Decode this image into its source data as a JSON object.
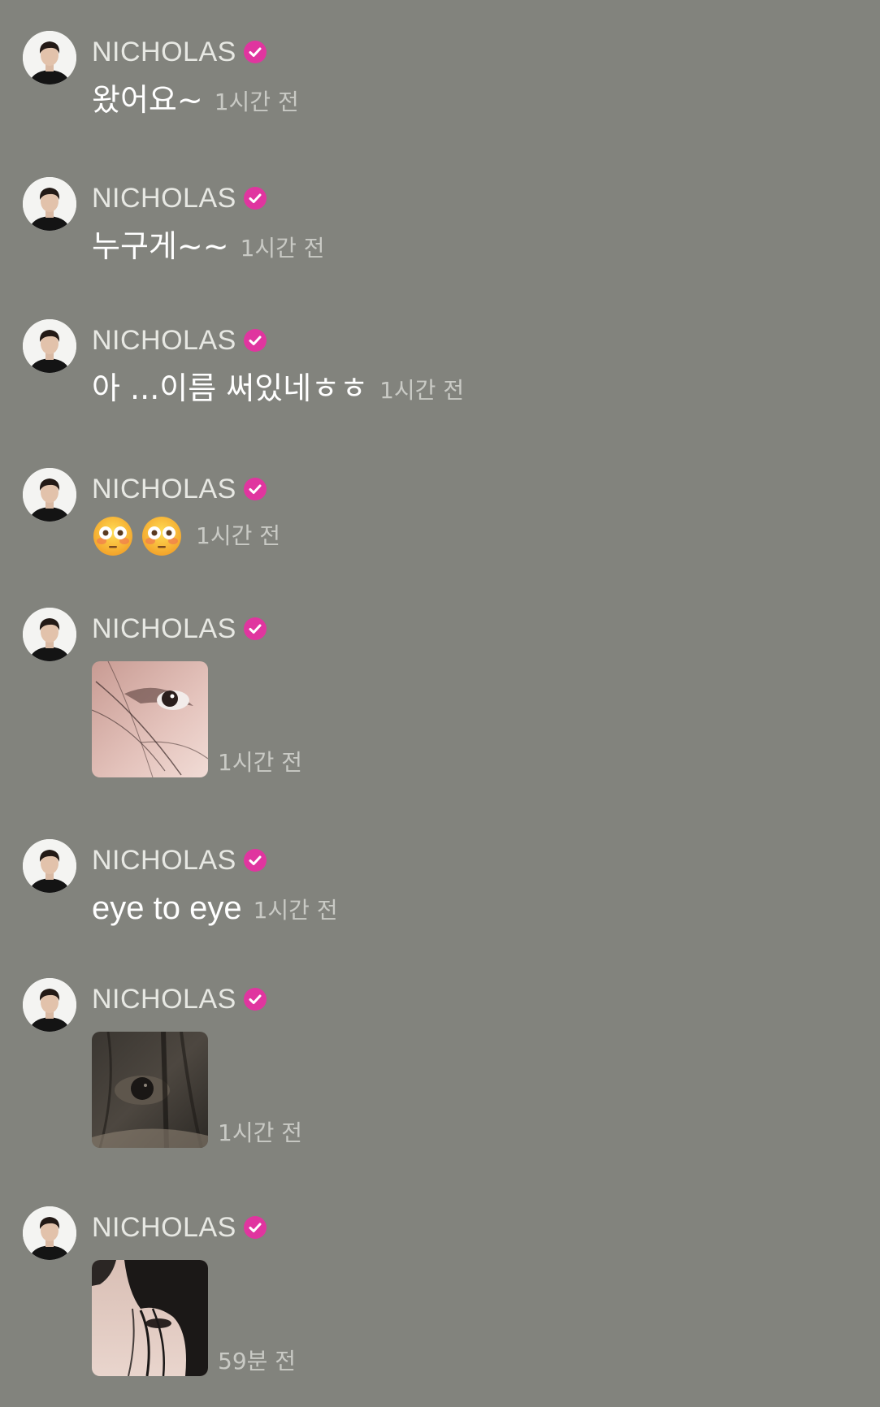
{
  "sender": {
    "name": "NICHOLAS",
    "verified": true,
    "badge_color": "#e0359f"
  },
  "colors": {
    "background": "#82837d",
    "message_text": "#ffffff",
    "name_text": "#e7e8e3",
    "time_text": "#c9cac5"
  },
  "messages": [
    {
      "type": "text",
      "text": "왔어요~",
      "time": "1시간 전"
    },
    {
      "type": "text",
      "text": "누구게~~",
      "time": "1시간 전"
    },
    {
      "type": "text",
      "text": "아 ...이름 써있네ㅎㅎ",
      "time": "1시간 전"
    },
    {
      "type": "emoji",
      "emojis": [
        "flushed-face-icon",
        "flushed-face-icon"
      ],
      "time": "1시간 전"
    },
    {
      "type": "image",
      "image": "eye-closeup-photo",
      "time": "1시간 전"
    },
    {
      "type": "text",
      "text": "eye to eye",
      "time": "1시간 전"
    },
    {
      "type": "image",
      "image": "dark-eye-photo",
      "time": "1시간 전"
    },
    {
      "type": "image",
      "image": "hair-over-face-photo",
      "time": "59분 전"
    }
  ]
}
